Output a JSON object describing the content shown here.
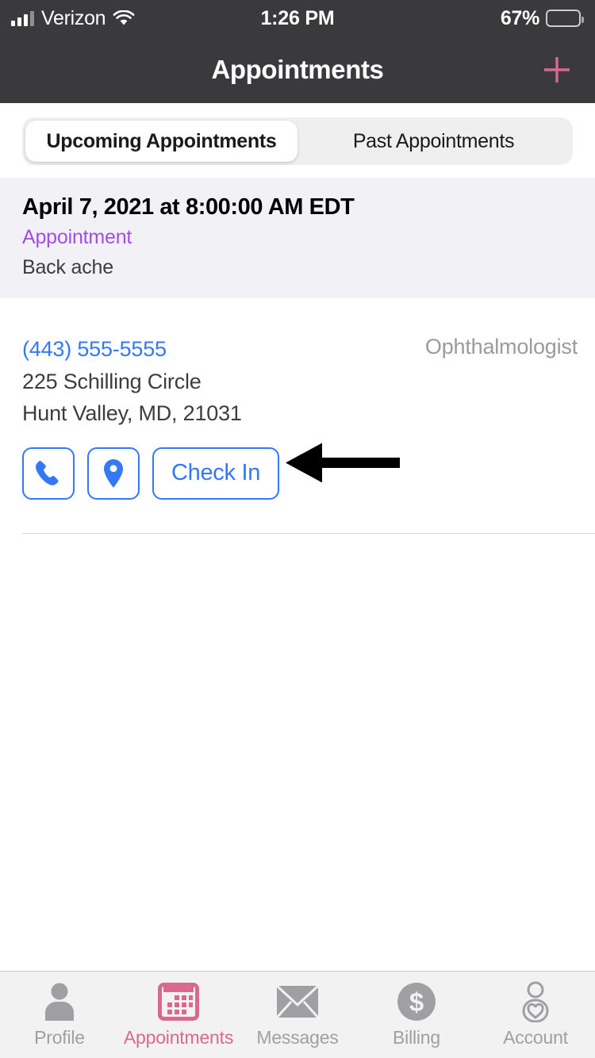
{
  "status_bar": {
    "carrier": "Verizon",
    "signal_icon": "signal-bars-icon",
    "wifi_icon": "wifi-icon",
    "time": "1:26 PM",
    "battery_percent": "67%",
    "battery_level": 67,
    "battery_icon": "battery-icon"
  },
  "header": {
    "title": "Appointments",
    "add_icon": "plus-icon",
    "background": "#3a3a3c",
    "accent": "#d9698f"
  },
  "segmented_control": {
    "selected_index": 0,
    "options": [
      {
        "label": "Upcoming Appointments"
      },
      {
        "label": "Past Appointments"
      }
    ]
  },
  "appointment": {
    "section": {
      "date": "April 7, 2021 at 8:00:00 AM EDT",
      "type": "Appointment",
      "type_color": "#a24fe0",
      "reason": "Back ache",
      "background": "#f2f1f6"
    },
    "provider": {
      "phone": "(443) 555-5555",
      "phone_color": "#3478f6",
      "address_line1": "225 Schilling Circle",
      "address_line2": "Hunt Valley, MD, 21031",
      "specialty": "Ophthalmologist"
    },
    "actions": {
      "accent": "#3478f6",
      "call_icon": "phone-icon",
      "call_name": "call-button",
      "directions_icon": "map-pin-icon",
      "directions_name": "directions-button",
      "check_in_label": "Check In"
    },
    "annotation": {
      "type": "arrow",
      "direction": "left",
      "points_at": "Check In",
      "color": "#000000"
    }
  },
  "tab_bar": {
    "active_index": 1,
    "active_color": "#d9698f",
    "inactive_color": "#a0a0a4",
    "items": [
      {
        "label": "Profile",
        "icon": "person-icon"
      },
      {
        "label": "Appointments",
        "icon": "calendar-icon"
      },
      {
        "label": "Messages",
        "icon": "envelope-icon"
      },
      {
        "label": "Billing",
        "icon": "dollar-circle-icon"
      },
      {
        "label": "Account",
        "icon": "person-heart-icon"
      }
    ]
  }
}
